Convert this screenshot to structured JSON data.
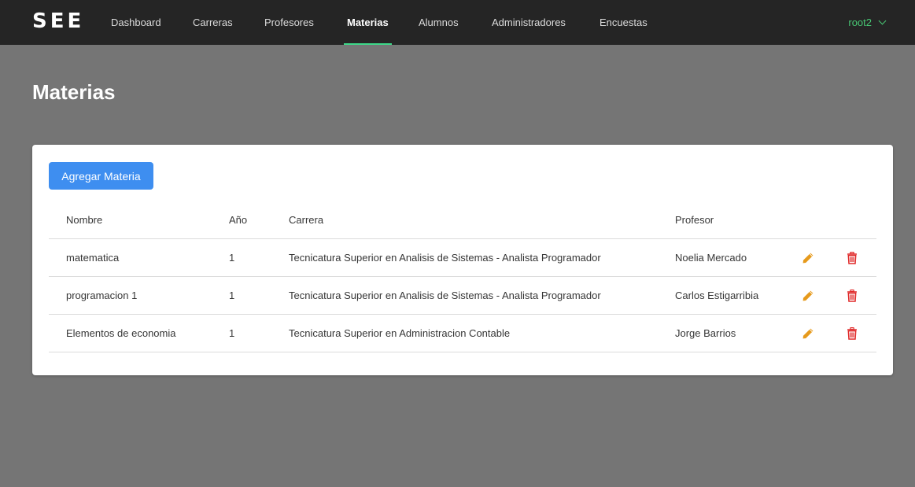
{
  "brand": "SEE",
  "nav": {
    "items": [
      {
        "label": "Dashboard"
      },
      {
        "label": "Carreras"
      },
      {
        "label": "Profesores"
      },
      {
        "label": "Materias"
      },
      {
        "label": "Alumnos"
      },
      {
        "label": "Administradores"
      },
      {
        "label": "Encuestas"
      }
    ],
    "active": "Materias",
    "user": "root2"
  },
  "page": {
    "title": "Materias"
  },
  "toolbar": {
    "add_label": "Agregar Materia"
  },
  "table": {
    "headers": {
      "nombre": "Nombre",
      "anio": "Año",
      "carrera": "Carrera",
      "profesor": "Profesor"
    },
    "rows": [
      {
        "nombre": "matematica",
        "anio": "1",
        "carrera": "Tecnicatura Superior en Analisis de Sistemas - Analista Programador",
        "profesor": "Noelia Mercado"
      },
      {
        "nombre": "programacion 1",
        "anio": "1",
        "carrera": "Tecnicatura Superior en Analisis de Sistemas - Analista Programador",
        "profesor": "Carlos Estigarribia"
      },
      {
        "nombre": "Elementos de economia",
        "anio": "1",
        "carrera": "Tecnicatura Superior en Administracion Contable",
        "profesor": "Jorge Barrios"
      }
    ]
  },
  "icons": {
    "edit": "pencil-icon",
    "delete": "trash-icon"
  },
  "colors": {
    "navbar": "#252525",
    "background": "#757575",
    "accent": "#3ed889",
    "user": "#48c774",
    "primary_button": "#3e8ef0",
    "edit_icon": "#e69a1c",
    "delete_icon": "#e02a2a"
  }
}
